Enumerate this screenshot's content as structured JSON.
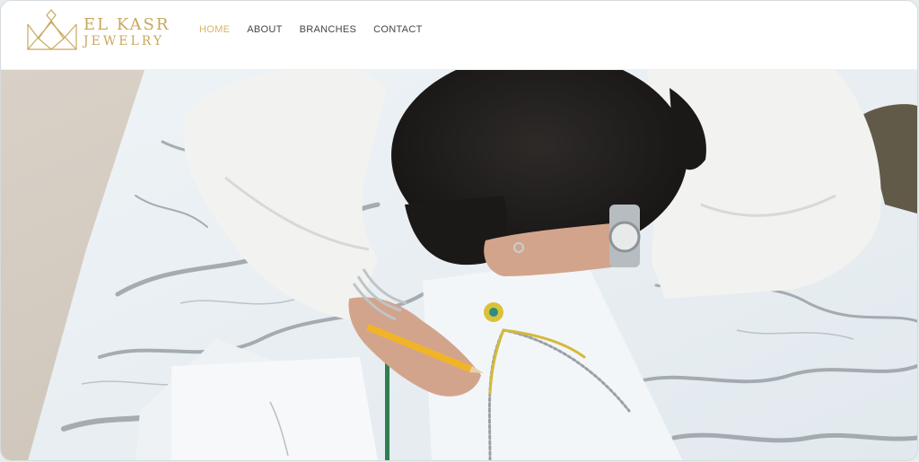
{
  "brand": {
    "name_line1": "EL KASR",
    "name_line2": "JEWELRY",
    "color": "#c9a85c",
    "icon": "crown-diamond-logo-icon"
  },
  "nav": {
    "items": [
      {
        "label": "HOME",
        "active": true
      },
      {
        "label": "ABOUT",
        "active": false
      },
      {
        "label": "BRANCHES",
        "active": false
      },
      {
        "label": "CONTACT",
        "active": false
      }
    ],
    "active_color": "#d8b56a",
    "color": "#444444"
  },
  "hero": {
    "image": "woman-sketching-jewelry-on-marble-table"
  }
}
